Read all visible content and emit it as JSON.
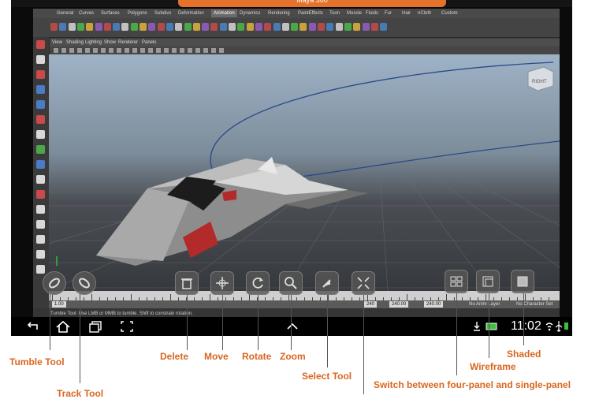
{
  "screen": {
    "notification_text": "Maya 360",
    "shelf_tabs": [
      "General",
      "Curves",
      "Surfaces",
      "Polygons",
      "Subdivs",
      "Deformation",
      "Animation",
      "Dynamics",
      "Rendering",
      "PaintEffects",
      "Toon",
      "Muscle",
      "Fluids",
      "Fur",
      "Hair",
      "nCloth",
      "Custom"
    ],
    "active_shelf_tab": "Animation",
    "panel_menu": [
      "View",
      "Shading",
      "Lighting",
      "Show",
      "Renderer",
      "Panels"
    ],
    "viewcube_label": "RIGHT",
    "help_line": "Tumble Tool: Use LMB or MMB to tumble. Shift to constrain rotation.",
    "range": {
      "start": "1.00",
      "end": "240",
      "anim_end": "240.00",
      "anim_end2": "240.00"
    },
    "layer_text": "No Anim Layer",
    "character_text": "No Character Set",
    "clock": "11:02"
  },
  "callouts": {
    "tumble": "Tumble Tool",
    "track": "Track Tool",
    "delete": "Delete",
    "move": "Move",
    "rotate": "Rotate",
    "zoom": "Zoom",
    "select": "Select Tool",
    "switch": "Switch between four-panel and single-panel",
    "wireframe": "Wireframe",
    "shaded": "Shaded"
  },
  "colors": {
    "callout": "#d9661f",
    "notification": "#e4722a"
  },
  "icons": [
    "tumble-icon",
    "track-icon",
    "trash-icon",
    "move-icon",
    "rotate-icon",
    "zoom-icon",
    "select-arrow-icon",
    "four-panel-icon",
    "wireframe-icon",
    "shaded-icon",
    "back-icon",
    "home-icon",
    "recent-apps-icon",
    "screenshot-icon",
    "menu-up-icon",
    "download-icon",
    "battery-icon",
    "wifi-icon",
    "airplane-icon"
  ]
}
